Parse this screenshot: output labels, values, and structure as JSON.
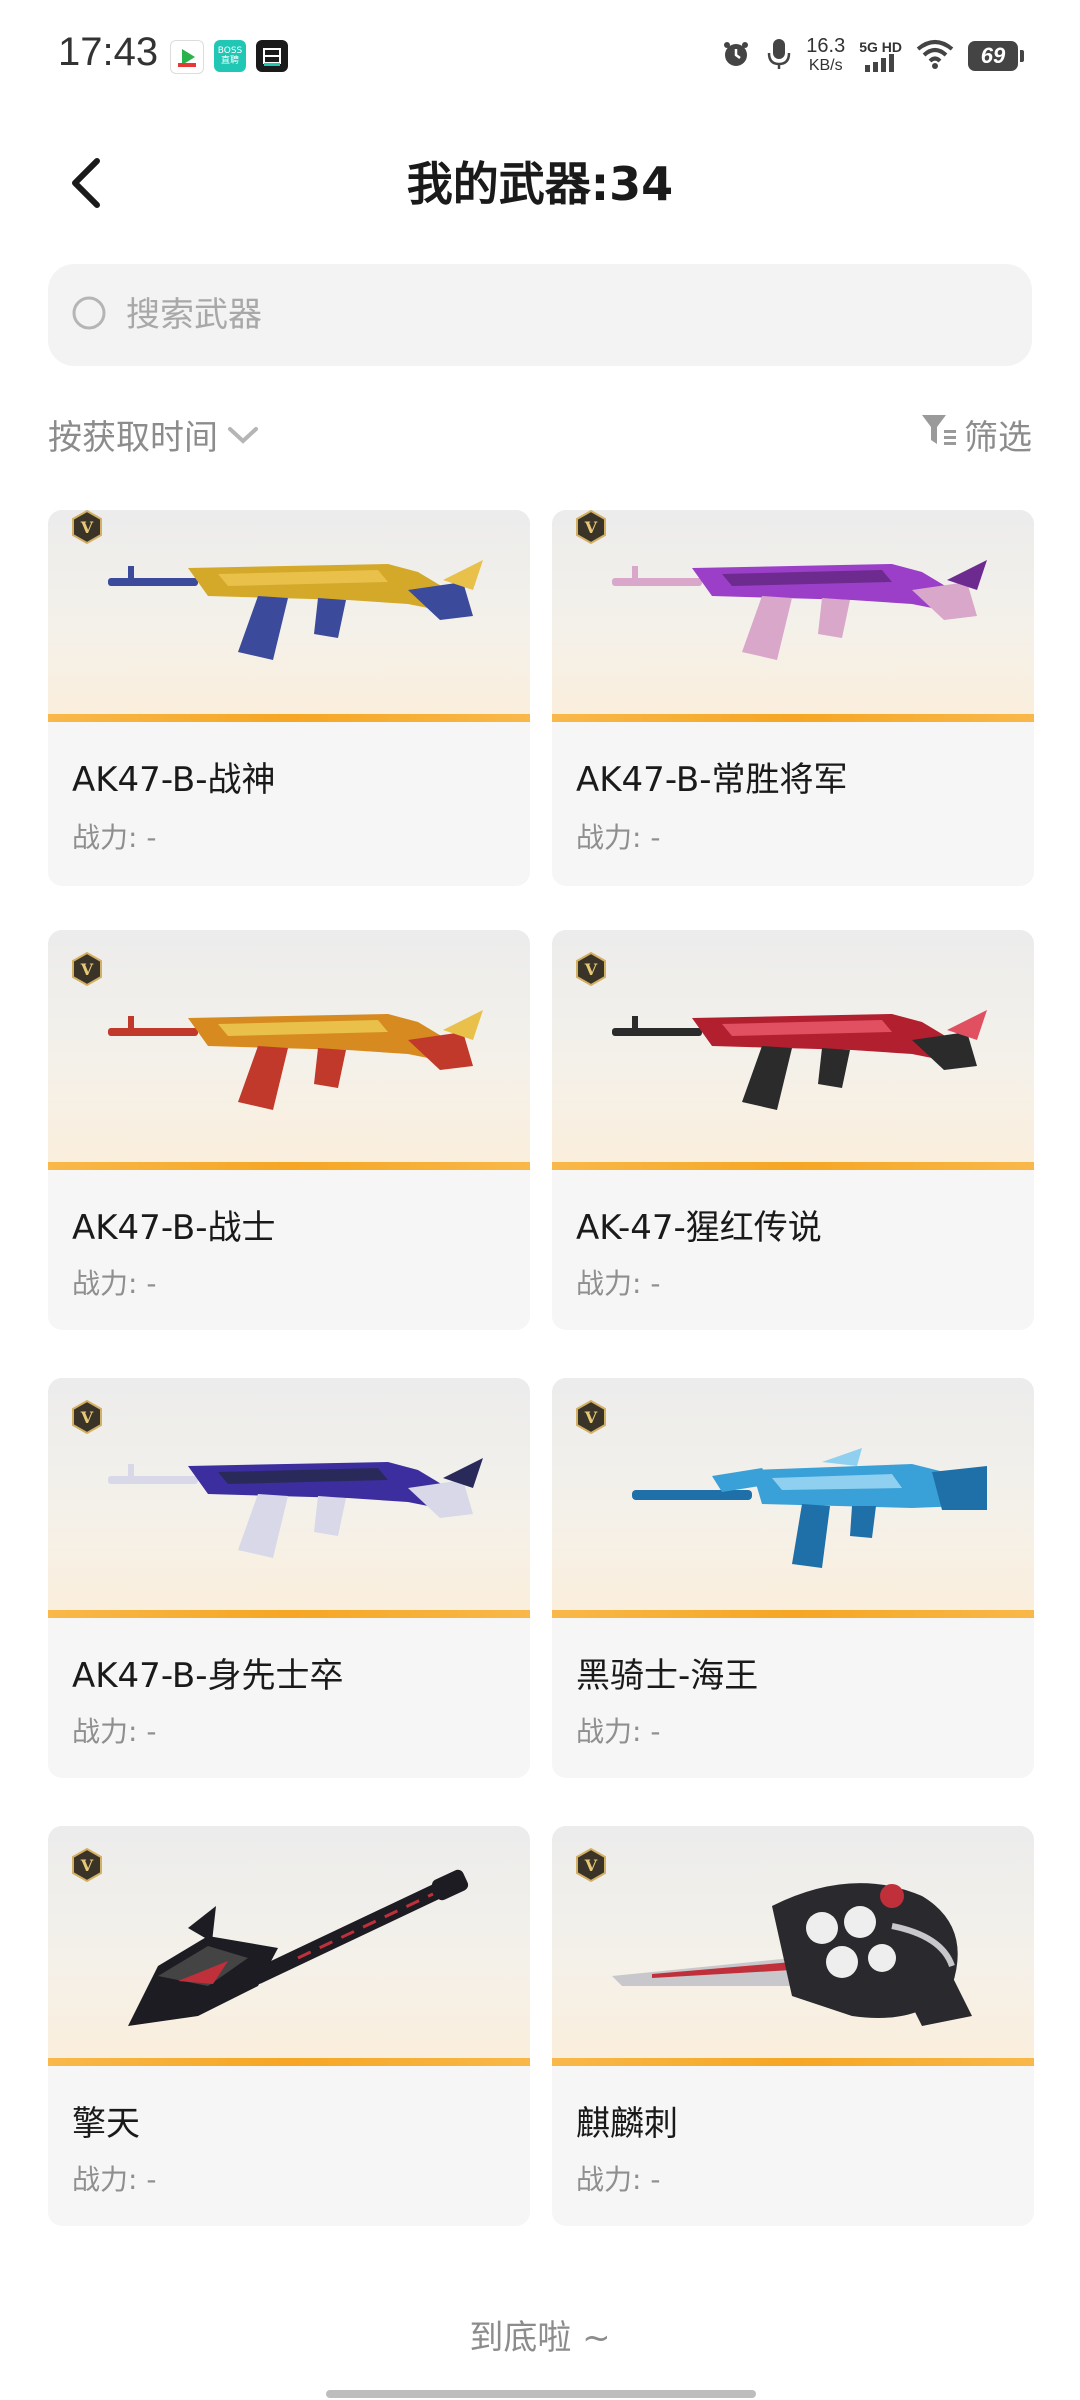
{
  "status_bar": {
    "time": "17:43",
    "apps": [
      "video-app-icon",
      "boss-zhipin-icon",
      "chess-app-icon"
    ],
    "boss_label": "BOSS 直聘",
    "speed_value": "16.3",
    "speed_unit": "KB/s",
    "network": "5G HD",
    "battery": "69"
  },
  "header": {
    "title": "我的武器:34"
  },
  "search": {
    "placeholder": "搜索武器"
  },
  "toolbar": {
    "sort_label": "按获取时间",
    "filter_label": "筛选"
  },
  "weapons": [
    {
      "name": "AK47-B-战神",
      "power": "战力: -",
      "colors": [
        "#d4a829",
        "#3b4a9a",
        "#e8c04a"
      ]
    },
    {
      "name": "AK47-B-常胜将军",
      "power": "战力: -",
      "colors": [
        "#9b3fc9",
        "#d8a7c9",
        "#6d2a8f"
      ]
    },
    {
      "name": "AK47-B-战士",
      "power": "战力: -",
      "colors": [
        "#d68a1f",
        "#c0392b",
        "#e8c04a"
      ]
    },
    {
      "name": "AK-47-猩红传说",
      "power": "战力: -",
      "colors": [
        "#b22030",
        "#2b2b2b",
        "#e05060"
      ]
    },
    {
      "name": "AK47-B-身先士卒",
      "power": "战力: -",
      "colors": [
        "#3c2e9e",
        "#d8d8e8",
        "#2a2a5a"
      ]
    },
    {
      "name": "黑骑士-海王",
      "power": "战力: -",
      "colors": [
        "#3aa0d8",
        "#1f6fa8",
        "#8fd0f0"
      ]
    },
    {
      "name": "擎天",
      "power": "战力: -",
      "colors": [
        "#1c1c22",
        "#c0303a",
        "#444"
      ]
    },
    {
      "name": "麒麟刺",
      "power": "战力: -",
      "colors": [
        "#2a2a2e",
        "#c8c8cc",
        "#c0303a"
      ]
    }
  ],
  "footer": {
    "end_text": "到底啦 ~"
  }
}
